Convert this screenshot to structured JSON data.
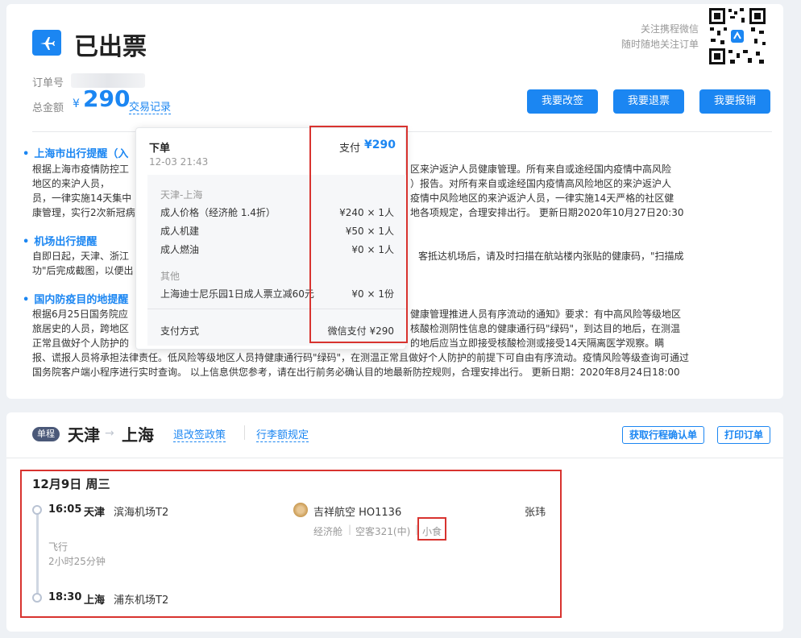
{
  "header": {
    "title": "已出票",
    "follow_line1": "关注携程微信",
    "follow_line2": "随时随地关注订单",
    "order_label": "订单号",
    "total_label": "总金额",
    "currency": "¥",
    "total_amount": "290",
    "trade_record_link": "交易记录",
    "buttons": {
      "change": "我要改签",
      "refund": "我要退票",
      "reimburse": "我要报销"
    }
  },
  "notices": [
    {
      "title": "上海市出行提醒（入",
      "body_lines": [
        "根据上海市疫情防控工",
        "地区的来沪人员，",
        "员，一律实施14天集中",
        "康管理，实行2次新冠病"
      ],
      "body_right_lines": [
        "区来沪返沪人员健康管理。所有来自或途经国内疫情中高风险",
        "）报告。对所有来自或途经国内疫情高风险地区的来沪返沪人",
        "疫情中风险地区的来沪返沪人员，一律实施14天严格的社区健",
        "地各项规定，合理安排出行。 更新日期2020年10月27日20:30"
      ]
    },
    {
      "title": "机场出行提醒",
      "body_lines": [
        "自即日起，天津、浙江",
        "功\"后完成截图，以便出"
      ],
      "body_right_lines": [
        "客抵达机场后，请及时扫描在航站楼内张贴的健康码，\"扫描成"
      ]
    },
    {
      "title": "国内防疫目的地提醒",
      "body_lines": [
        "根据6月25日国务院应",
        "旅居史的人员，跨地区",
        "正常且做好个人防护的",
        "报、谎报人员将承担法律责任。低风险等级地区人员持健康通行码\"绿码\"，在测温正常且做好个人防护的前提下可自由有序流动。疫情风险等级查询可通过",
        "国务院客户端小程序进行实时查询。 以上信息供您参考，请在出行前务必确认目的地最新防控规则，合理安排出行。 更新日期：2020年8月24日18:00"
      ],
      "body_right_lines": [
        "健康管理推进人员有序流动的通知》要求：有中高风险等级地区",
        "核酸检测阴性信息的健康通行码\"绿码\"，到达目的地后，在测温",
        "的地后应当立即接受核酸检测或接受14天隔离医学观察。瞒"
      ]
    }
  ],
  "popup": {
    "order_label": "下单",
    "order_time": "12-03 21:43",
    "pay_label": "支付",
    "pay_amount": "¥290",
    "route_title": "天津-上海",
    "items": [
      {
        "label": "成人价格（经济舱 1.4折）",
        "value": "¥240 × 1人"
      },
      {
        "label": "成人机建",
        "value": "¥50 × 1人"
      },
      {
        "label": "成人燃油",
        "value": "¥0 × 1人"
      }
    ],
    "other_title": "其他",
    "other_items": [
      {
        "label": "上海迪士尼乐园1日成人票立减60元",
        "value": "¥0 × 1份"
      }
    ],
    "pay_method_label": "支付方式",
    "pay_method_value": "微信支付 ¥290"
  },
  "trip": {
    "tag": "单程",
    "from": "天津",
    "to": "上海",
    "arrow": "→",
    "policy_link": "退改签政策",
    "baggage_link": "行李额规定",
    "btn_itinerary": "获取行程确认单",
    "btn_print": "打印订单",
    "date": "12月9日 周三",
    "depart_time": "16:05",
    "depart_city": "天津",
    "depart_airport": "滨海机场T2",
    "fly_label": "飞行",
    "duration": "2小时25分钟",
    "arrive_time": "18:30",
    "arrive_city": "上海",
    "arrive_airport": "浦东机场T2",
    "airline": "吉祥航空 HO1136",
    "cabin": "经济舱",
    "aircraft": "空客321(中)",
    "meal": "小食",
    "passenger": "张玮"
  },
  "colors": {
    "accent": "#1b86f2",
    "highlight_border": "#d8332f"
  }
}
